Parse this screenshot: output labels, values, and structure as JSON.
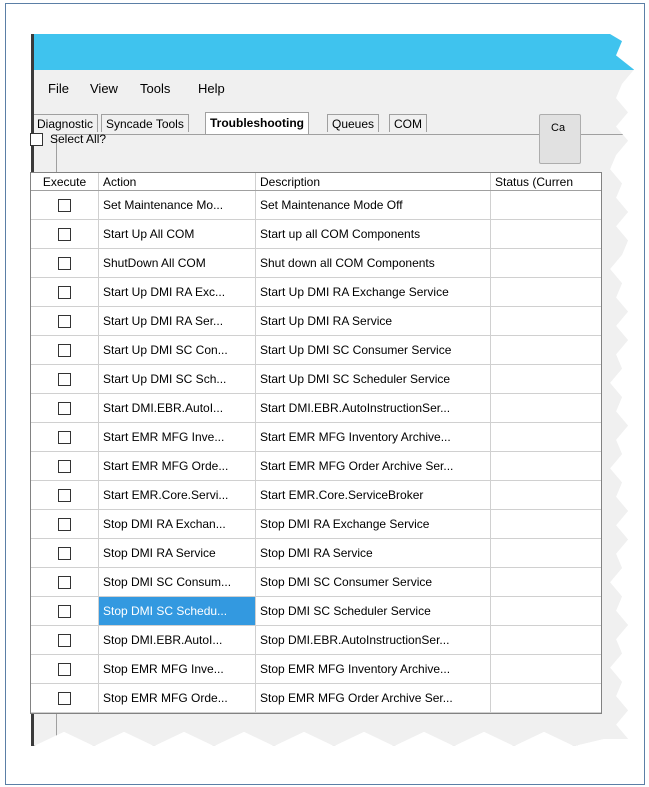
{
  "menu": [
    "File",
    "View",
    "Tools",
    "Help"
  ],
  "tabs": [
    {
      "label": "Diagnostic",
      "active": false
    },
    {
      "label": "Syncade Tools",
      "active": false
    },
    {
      "label": "Troubleshooting",
      "active": true
    },
    {
      "label": "Queues",
      "active": false
    },
    {
      "label": "COM",
      "active": false
    }
  ],
  "select_all_label": "Select All?",
  "side_button_label": "Ca",
  "grid": {
    "headers": [
      "Execute",
      "Action",
      "Description",
      "Status (Curren"
    ],
    "rows": [
      {
        "action": "Set Maintenance Mo...",
        "description": "Set Maintenance Mode Off",
        "selected": false
      },
      {
        "action": "Start Up All COM",
        "description": "Start up all COM Components",
        "selected": false
      },
      {
        "action": "ShutDown All COM",
        "description": "Shut down all COM Components",
        "selected": false
      },
      {
        "action": "Start Up DMI RA Exc...",
        "description": "Start Up DMI RA Exchange Service",
        "selected": false
      },
      {
        "action": "Start Up DMI RA Ser...",
        "description": "Start Up DMI RA Service",
        "selected": false
      },
      {
        "action": "Start Up DMI SC Con...",
        "description": "Start Up DMI SC Consumer Service",
        "selected": false
      },
      {
        "action": "Start Up DMI SC Sch...",
        "description": "Start Up DMI SC Scheduler Service",
        "selected": false
      },
      {
        "action": "Start DMI.EBR.AutoI...",
        "description": "Start DMI.EBR.AutoInstructionSer...",
        "selected": false
      },
      {
        "action": "Start EMR MFG Inve...",
        "description": "Start EMR MFG Inventory Archive...",
        "selected": false
      },
      {
        "action": "Start EMR MFG Orde...",
        "description": "Start EMR MFG Order Archive Ser...",
        "selected": false
      },
      {
        "action": "Start EMR.Core.Servi...",
        "description": "Start EMR.Core.ServiceBroker",
        "selected": false
      },
      {
        "action": "Stop DMI RA Exchan...",
        "description": "Stop DMI RA Exchange Service",
        "selected": false
      },
      {
        "action": "Stop DMI RA Service",
        "description": "Stop DMI RA Service",
        "selected": false
      },
      {
        "action": "Stop DMI SC Consum...",
        "description": "Stop DMI SC Consumer Service",
        "selected": false
      },
      {
        "action": "Stop DMI SC Schedu...",
        "description": "Stop DMI SC Scheduler Service",
        "selected": true
      },
      {
        "action": "Stop DMI.EBR.AutoI...",
        "description": "Stop DMI.EBR.AutoInstructionSer...",
        "selected": false
      },
      {
        "action": "Stop EMR MFG Inve...",
        "description": "Stop EMR MFG Inventory Archive...",
        "selected": false
      },
      {
        "action": "Stop EMR MFG Orde...",
        "description": "Stop EMR MFG Order Archive Ser...",
        "selected": false
      }
    ]
  },
  "colors": {
    "titlebar": "#3fc3ee",
    "selection": "#3399e0"
  }
}
